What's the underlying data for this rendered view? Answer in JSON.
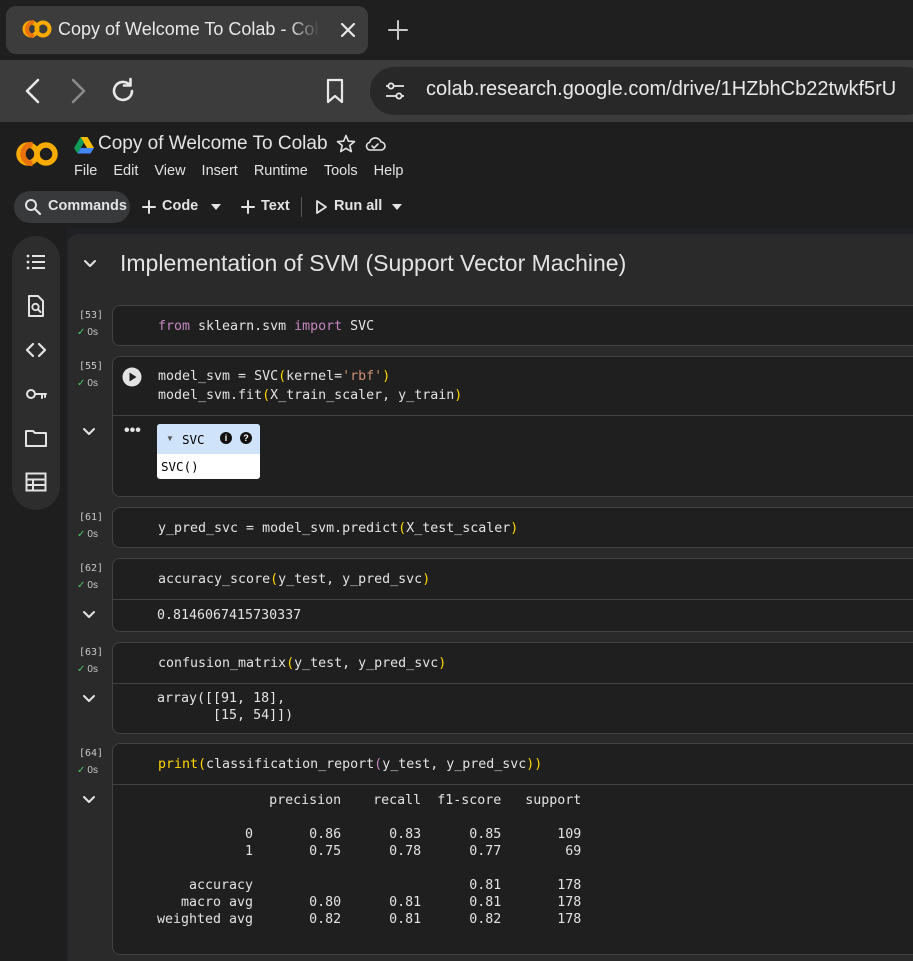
{
  "browser": {
    "tab_title": "Copy of Welcome To Colab - Colab",
    "new_tab_label": "+",
    "url": "colab.research.google.com/drive/1HZbhCb22twkf5rU"
  },
  "colab": {
    "doc_title": "Copy of Welcome To Colab",
    "menu": [
      "File",
      "Edit",
      "View",
      "Insert",
      "Runtime",
      "Tools",
      "Help"
    ],
    "toolbar": {
      "commands": "Commands",
      "code": "Code",
      "text": "Text",
      "run_all": "Run all"
    }
  },
  "section": {
    "title": "Implementation of SVM (Support Vector Machine)"
  },
  "cells": {
    "c53": {
      "count": "[53]",
      "status": "0s"
    },
    "c55": {
      "count": "[55]",
      "status": "0s",
      "widget": {
        "name": "SVC",
        "info_badge": "i",
        "help_badge": "?",
        "repr": "SVC()"
      }
    },
    "c61": {
      "count": "[61]",
      "status": "0s"
    },
    "c62": {
      "count": "[62]",
      "status": "0s",
      "output": "0.8146067415730337"
    },
    "c63": {
      "count": "[63]",
      "status": "0s",
      "output": "array([[91, 18],\n       [15, 54]])"
    },
    "c64": {
      "count": "[64]",
      "status": "0s",
      "output": "              precision    recall  f1-score   support\n\n           0       0.86      0.83      0.85       109\n           1       0.75      0.78      0.77        69\n\n    accuracy                           0.81       178\n   macro avg       0.80      0.81      0.81       178\nweighted avg       0.82      0.81      0.82       178"
    }
  },
  "code_tokens": {
    "from": "from",
    "sklearn_svm": " sklearn.svm ",
    "import": "import",
    "svc_import": " SVC",
    "l55a_1": "model_svm = SVC",
    "l55a_p1": "(",
    "l55a_2": "kernel=",
    "l55a_str": "'rbf'",
    "l55a_p2": ")",
    "l55b_1": "model_svm.fit",
    "l55b_p1": "(",
    "l55b_2": "X_train_scaler, y_train",
    "l55b_p2": ")",
    "l61_1": "y_pred_svc = model_svm.predict",
    "l61_p1": "(",
    "l61_2": "X_test_scaler",
    "l61_p2": ")",
    "l62_1": "accuracy_score",
    "l62_p1": "(",
    "l62_2": "y_test, y_pred_svc",
    "l62_p2": ")",
    "l63_1": "confusion_matrix",
    "l63_p1": "(",
    "l63_2": "y_test, y_pred_svc",
    "l63_p2": ")",
    "l64_print": "print",
    "l64_p1": "(",
    "l64_1": "classification_report",
    "l64_p2": "(",
    "l64_2": "y_test, y_pred_svc",
    "l64_p3": "))"
  },
  "colors": {
    "background": "#1e1e1e",
    "accent_orange": "#f9ab00",
    "keyword": "#c586c0",
    "string": "#ce9178",
    "bracket": "#ffd700",
    "success": "#4ec96a"
  }
}
